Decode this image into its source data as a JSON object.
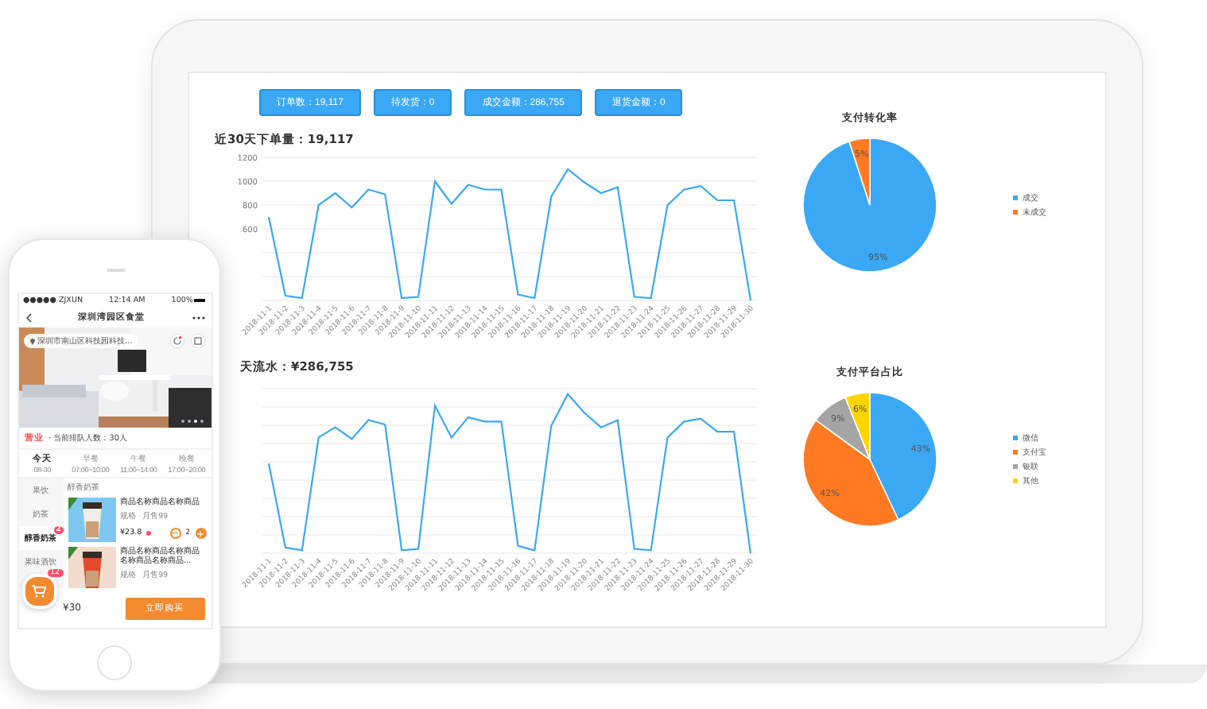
{
  "laptop": {
    "stats": [
      {
        "label": "订单数：19,117"
      },
      {
        "label": "待发货：0"
      },
      {
        "label": "成交金额：286,755"
      },
      {
        "label": "退货金额：0"
      }
    ],
    "orders_chart": {
      "chart_data": {
        "type": "line",
        "title": "近30天下单量：19,117",
        "categories": [
          "2018-11-1",
          "2018-11-2",
          "2018-11-3",
          "2018-11-4",
          "2018-11-5",
          "2018-11-6",
          "2018-11-7",
          "2018-11-8",
          "2018-11-9",
          "2018-11-10",
          "2018-11-11",
          "2018-11-12",
          "2018-11-13",
          "2018-11-14",
          "2018-11-15",
          "2018-11-16",
          "2018-11-17",
          "2018-11-18",
          "2018-11-19",
          "2018-11-20",
          "2018-11-21",
          "2018-11-22",
          "2018-11-23",
          "2018-11-24",
          "2018-11-25",
          "2018-11-26",
          "2018-11-27",
          "2018-11-28",
          "2018-11-29",
          "2018-11-30"
        ],
        "series": [
          {
            "color": "#3aa8f5",
            "values": [
              700,
              40,
              20,
              800,
              900,
              780,
              930,
              890,
              20,
              30,
              1000,
              810,
              970,
              930,
              930,
              50,
              20,
              870,
              1100,
              990,
              900,
              950,
              30,
              20,
              800,
              930,
              960,
              840,
              840,
              0
            ]
          }
        ],
        "ylim": [
          0,
          1200
        ],
        "yticks": [
          600,
          800,
          1000,
          1200
        ],
        "grid": true
      }
    },
    "revenue_chart": {
      "title": "天流水：¥286,755",
      "x_labels": [
        "2018-11-1",
        "2018-11-2",
        "2018-11-3",
        "2018-11-4",
        "2018-11-5",
        "2018-11-6",
        "2018-11-7",
        "2018-11-8",
        "2018-11-9",
        "2018-11-10",
        "2018-11-11",
        "2018-11-12",
        "2018-11-13",
        "2018-11-14",
        "2018-11-15",
        "2018-11-16",
        "2018-11-17",
        "2018-11-18",
        "2018-11-19",
        "2018-11-20",
        "2018-11-21",
        "2018-11-22",
        "2018-11-23",
        "2018-11-24",
        "2018-11-25",
        "2018-11-26",
        "2018-11-27",
        "2018-11-28",
        "2018-11-29",
        "2018-11-30"
      ]
    },
    "conversion_chart": {
      "chart_data": {
        "type": "pie",
        "title": "支付转化率",
        "categories": [
          "成交",
          "未成交"
        ],
        "values": [
          95,
          5
        ],
        "value_labels": [
          "95%",
          "5%"
        ]
      },
      "legend": [
        {
          "color": "#3aa8f5"
        },
        {
          "color": "#ff7a22"
        }
      ]
    },
    "platform_chart": {
      "chart_data": {
        "type": "pie",
        "title": "支付平台占比",
        "categories": [
          "微信",
          "支付宝",
          "银联",
          "其他"
        ],
        "values": [
          43,
          42,
          9,
          6
        ],
        "value_labels": [
          "43%",
          "42%",
          "9%",
          "6%"
        ]
      },
      "legend": [
        {
          "color": "#3aa8f5"
        },
        {
          "color": "#ff7a22"
        },
        {
          "color": "#a5a5a5"
        },
        {
          "color": "#ffd400"
        }
      ]
    }
  },
  "phone": {
    "status_bar": {
      "carrier": "●●●●● ZJXUN",
      "time": "12:14 AM",
      "battery": "100%"
    },
    "title": "深圳湾园区食堂",
    "location": "深圳市南山区科技园科技...",
    "status": {
      "badge": "营业",
      "text": "· 当前排队人数：30人"
    },
    "meals": [
      {
        "label": "今天",
        "time": "08-30",
        "selected": true
      },
      {
        "label": "早餐",
        "time": "07:00~10:00",
        "selected": false
      },
      {
        "label": "午餐",
        "time": "11:00~14:00",
        "selected": false
      },
      {
        "label": "晚餐",
        "time": "17:00~20:00",
        "selected": false
      }
    ],
    "categories": [
      {
        "label": "果饮",
        "selected": false
      },
      {
        "label": "奶茶",
        "selected": false
      },
      {
        "label": "醇香奶茶",
        "selected": true,
        "badge": "2"
      },
      {
        "label": "果味酒饮",
        "selected": false
      }
    ],
    "section": "醇香奶茶",
    "products": [
      {
        "name": "商品名称商品名称商品",
        "spec": "规格 ",
        "sales": "月售99",
        "price": "¥23.8",
        "quantity": "2"
      },
      {
        "name": "商品名称商品名称商品名称商品名称商品...",
        "spec": "规格 ",
        "sales": "月售99"
      }
    ],
    "cart": {
      "count": "12",
      "total": "¥30",
      "button": "立即购买"
    }
  }
}
